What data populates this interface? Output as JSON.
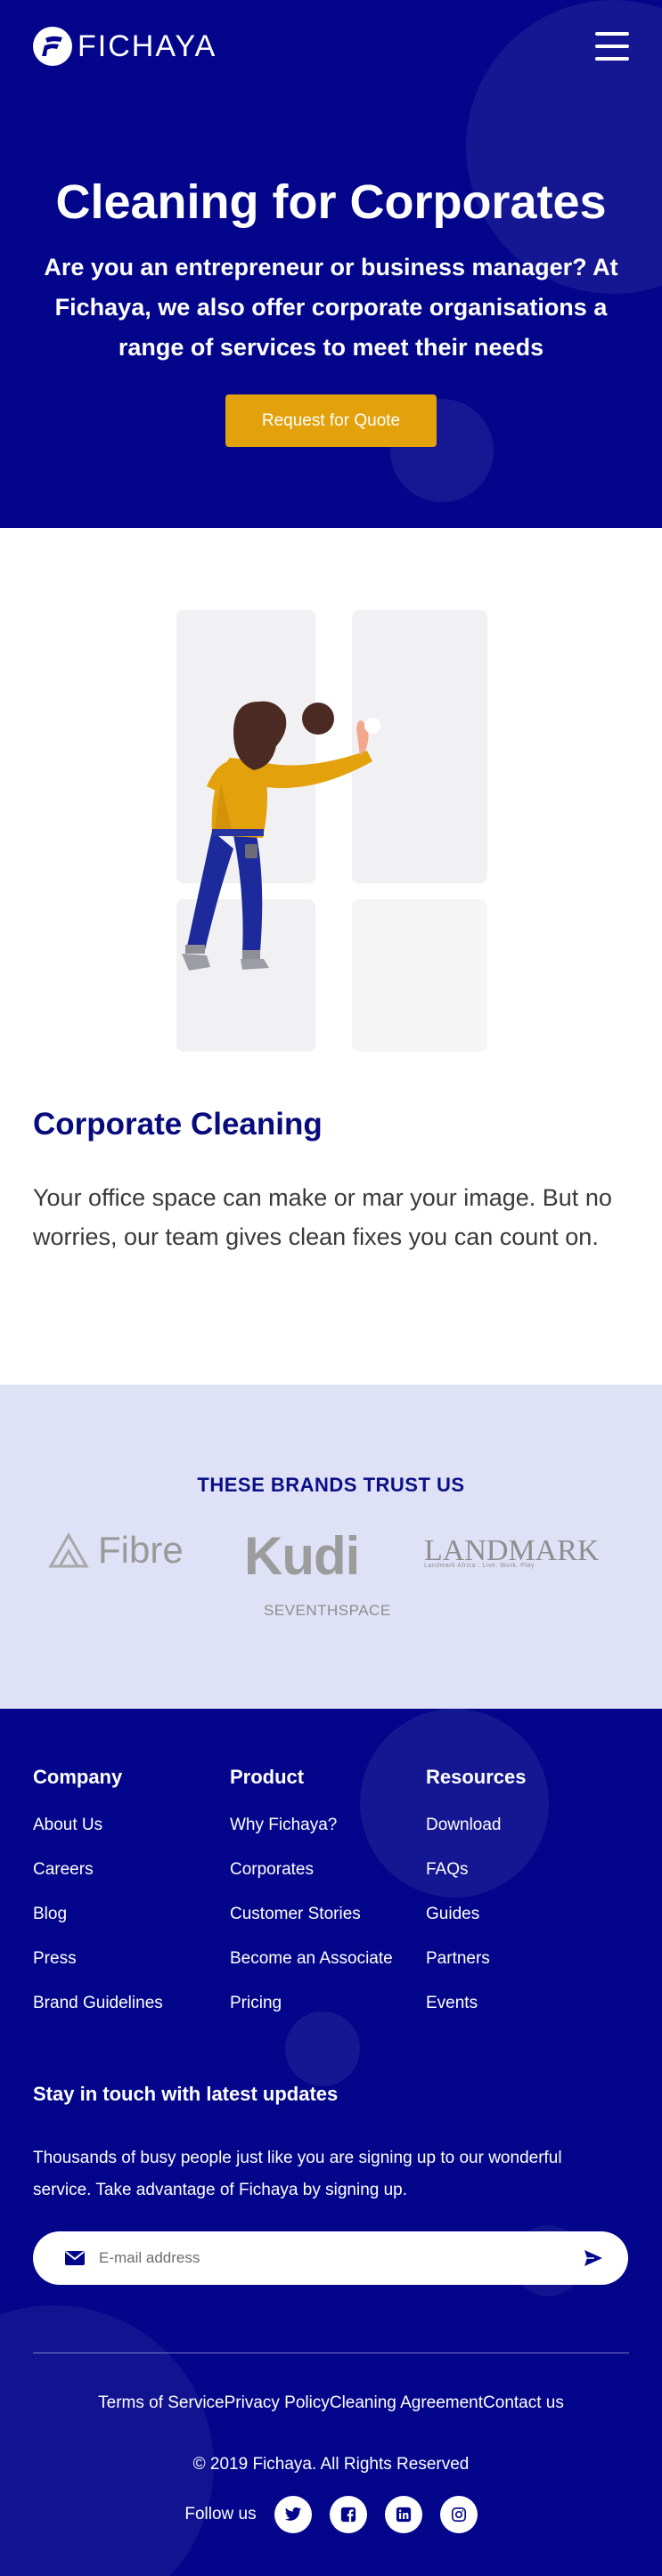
{
  "header": {
    "logo_text": "FICHAYA",
    "menu_icon": "hamburger-menu-icon"
  },
  "hero": {
    "title": "Cleaning for Corporates",
    "subtitle": "Are you an entrepreneur or business manager? At Fichaya, we also offer corporate organisations a range of services to meet their needs",
    "cta_label": "Request for Quote"
  },
  "service": {
    "title": "Corporate Cleaning",
    "description": "Your office space can make or mar your image. But no worries, our team gives clean fixes you can count on."
  },
  "brands": {
    "heading": "THESE BRANDS TRUST US",
    "logos": [
      {
        "name": "Fibre",
        "text": "Fibre"
      },
      {
        "name": "Kudi",
        "text": "Kudi"
      },
      {
        "name": "Landmark",
        "text": "LANDMARK",
        "tagline": "Landmark Africa . Live. Work. Play"
      },
      {
        "name": "Seventhspace",
        "text": "SEVENTHSPACE"
      }
    ]
  },
  "footer": {
    "columns": [
      {
        "title": "Company",
        "links": [
          "About Us",
          "Careers",
          "Blog",
          "Press",
          "Brand Guidelines"
        ]
      },
      {
        "title": "Product",
        "links": [
          "Why Fichaya?",
          "Corporates",
          "Customer Stories",
          "Become an Associate",
          "Pricing"
        ]
      },
      {
        "title": "Resources",
        "links": [
          "Download",
          "FAQs",
          "Guides",
          "Partners",
          "Events"
        ]
      }
    ],
    "newsletter": {
      "title": "Stay in touch with latest updates",
      "text": "Thousands of busy people just like you are signing up to our wonderful service. Take advantage of Fichaya by signing up.",
      "placeholder": "E-mail address",
      "value": ""
    },
    "legal_links": [
      "Terms of Service",
      "Privacy Policy",
      "Cleaning Agreement",
      "Contact us"
    ],
    "copyright": "© 2019 Fichaya. All Rights Reserved",
    "follow_label": "Follow us",
    "socials": [
      "twitter-icon",
      "facebook-icon",
      "linkedin-icon",
      "instagram-icon"
    ]
  },
  "colors": {
    "primary": "#03058a",
    "accent": "#e3a10c",
    "heading_blue": "#070b7c",
    "brands_bg": "#dfe1f6"
  }
}
